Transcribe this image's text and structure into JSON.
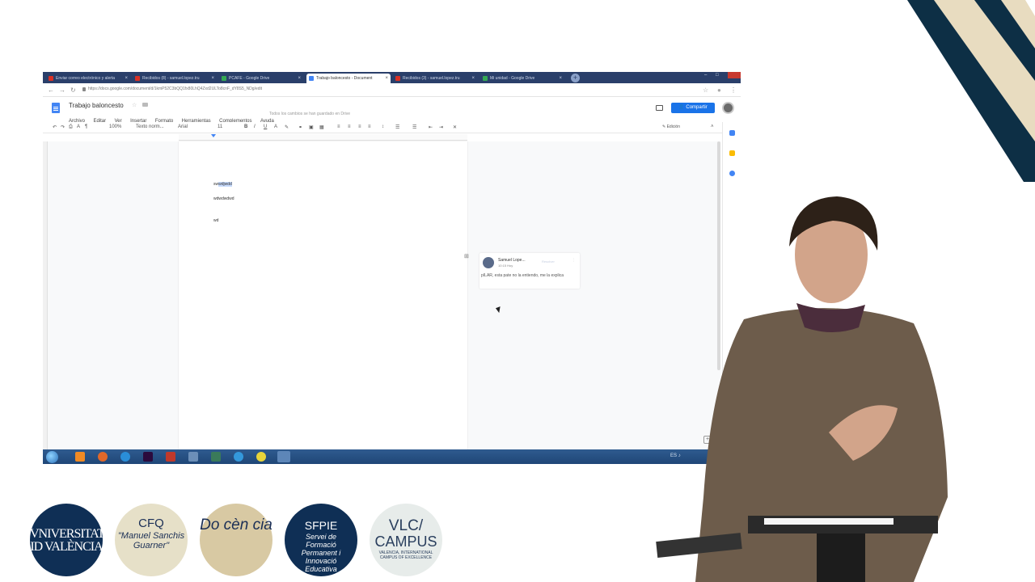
{
  "browser": {
    "tabs": [
      {
        "label": "Enviar correo electrónico y alerta",
        "favicon_color": "#d93025"
      },
      {
        "label": "Recibidos (8) - samuel.lopez.tru",
        "favicon_color": "#d93025"
      },
      {
        "label": "PCAFE - Google Drive",
        "favicon_color": "#34a853"
      },
      {
        "label": "Trabajo baloncesto - Document",
        "favicon_color": "#4285f4"
      },
      {
        "label": "Recibidos (3) - samuel.lopez.tru",
        "favicon_color": "#d93025"
      },
      {
        "label": "Mi unidad - Google Drive",
        "favicon_color": "#34a853"
      }
    ],
    "new_tab": "+",
    "url": "https://docs.google.com/document/d/1kmP52C3bQQ1fx80LhQ4Zxd2ULTo8cnF_dY8S5_NDg/edit"
  },
  "docs": {
    "title": "Trabajo baloncesto",
    "menu": [
      "Archivo",
      "Editar",
      "Ver",
      "Insertar",
      "Formato",
      "Herramientas",
      "Complementos",
      "Ayuda"
    ],
    "saved_message": "Todos los cambios se han guardado en Drive",
    "share_label": "Compartir",
    "toolbar": {
      "zoom": "100%",
      "style": "Texto norm...",
      "font": "Arial",
      "size": "11",
      "edit_mode": "Edición"
    },
    "body_lines": [
      "swdwdjwdd",
      "wdwdwdwd",
      "wd"
    ],
    "highlight": "wdjwdd",
    "comment": {
      "author": "Samuel Lope...",
      "time": "10:15 Hoy",
      "resolve": "Resolver",
      "text": "pILAR, esta pate no la entiendo, me la explica"
    }
  },
  "taskbar": {
    "tray_text": "ES"
  },
  "logos": {
    "uv_line1": "VNIVERSITAT",
    "uv_line2": "ID VALÈNCIA",
    "cfq_title": "CFQ",
    "cfq_sub": "\"Manuel Sanchis Guarner\"",
    "docencia": "Do cèn cia",
    "sfpie_title": "SFPIE",
    "sfpie_sub": "Servei de Formació Permanent i Innovació Educativa",
    "vlc_line1": "VLC/",
    "vlc_line2": "CAMPUS",
    "vlc_sub": "VALENCIA, INTERNATIONAL CAMPUS OF EXCELLENCE"
  },
  "colors": {
    "stripe_navy": "#0d2f45",
    "stripe_cream": "#e8dcc0",
    "share_blue": "#1a73e8",
    "taskbar_blue": "#2f5b8f"
  }
}
